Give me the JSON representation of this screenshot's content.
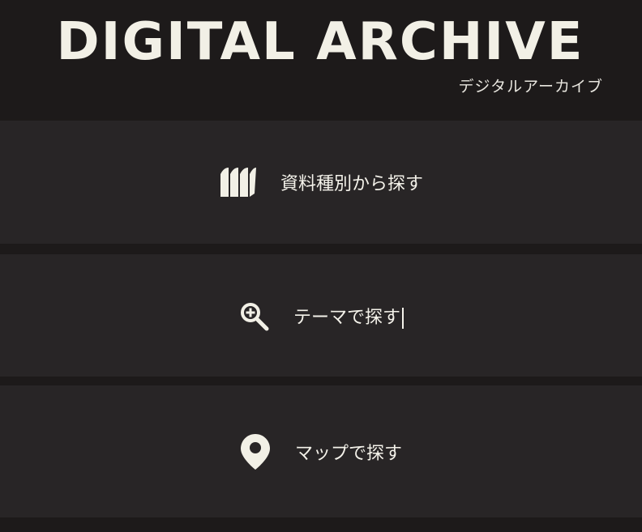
{
  "header": {
    "title": "DIGITAL ARCHIVE",
    "subtitle": "デジタルアーカイブ"
  },
  "menu": {
    "items": [
      {
        "label": "資料種別から探す",
        "icon": "books-icon"
      },
      {
        "label": "テーマで探す",
        "icon": "magnifier-plus-icon"
      },
      {
        "label": "マップで探す",
        "icon": "map-pin-icon"
      }
    ]
  },
  "colors": {
    "background": "#1d1a1a",
    "panel": "#282526",
    "text": "#f4f2ea"
  }
}
